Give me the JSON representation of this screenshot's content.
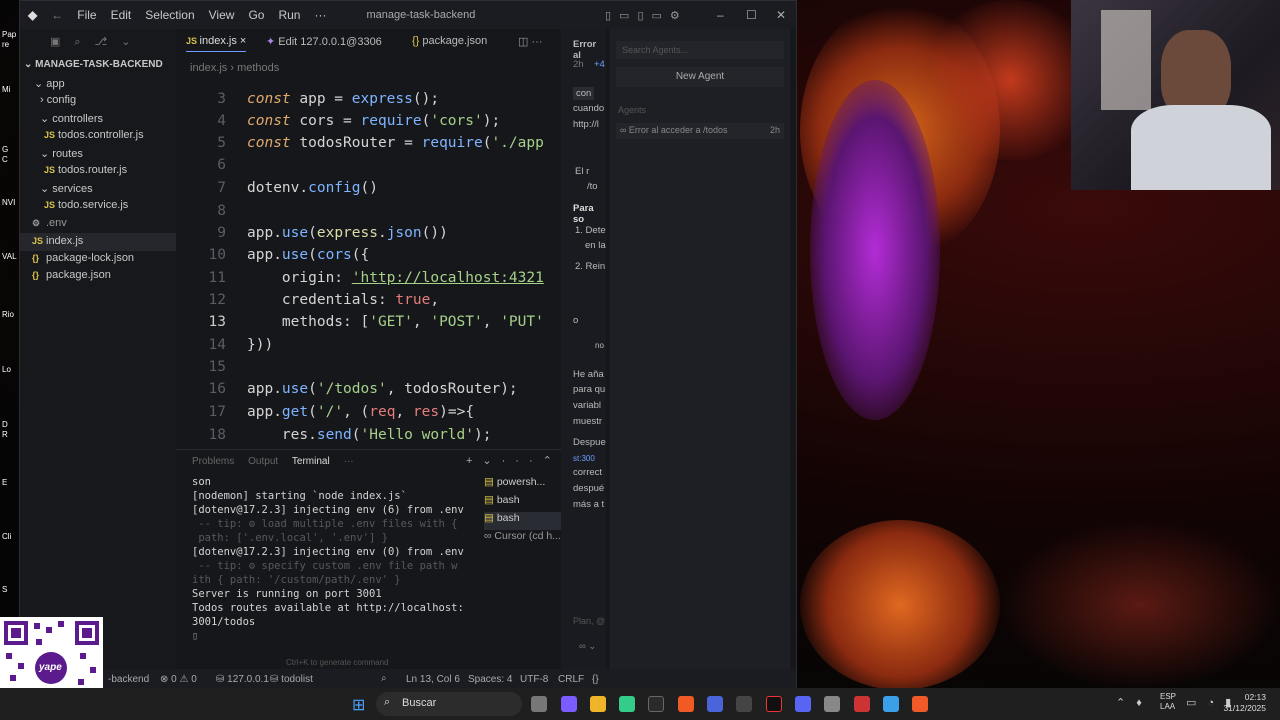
{
  "window": {
    "title": "manage-task-backend",
    "menu": [
      "File",
      "Edit",
      "Selection",
      "View",
      "Go",
      "Run",
      "···"
    ]
  },
  "tabs": [
    {
      "label": "index.js",
      "close": "×"
    },
    {
      "label": "Edit 127.0.0.1@3306"
    },
    {
      "label": "package.json"
    }
  ],
  "breadcrumb": {
    "file": "index.js",
    "sep": "›",
    "symbol": "methods"
  },
  "explorer": {
    "root": "MANAGE-TASK-BACKEND",
    "items": [
      {
        "label": "app",
        "icon": ""
      },
      {
        "label": "config",
        "icon": ""
      },
      {
        "label": "controllers",
        "icon": ""
      },
      {
        "label": "todos.controller.js",
        "icon": "JS"
      },
      {
        "label": "routes",
        "icon": ""
      },
      {
        "label": "todos.router.js",
        "icon": "JS"
      },
      {
        "label": "services",
        "icon": ""
      },
      {
        "label": "todo.service.js",
        "icon": "JS"
      },
      {
        "label": ".env",
        "icon": "⚙"
      },
      {
        "label": "index.js",
        "icon": "JS"
      },
      {
        "label": "package-lock.json",
        "icon": "{}"
      },
      {
        "label": "package.json",
        "icon": "{}"
      }
    ]
  },
  "code": {
    "lines": [
      "3",
      "4",
      "5",
      "6",
      "7",
      "8",
      "9",
      "10",
      "11",
      "12",
      "13",
      "14",
      "15",
      "16",
      "17",
      "18"
    ],
    "l3": [
      "const",
      " app = ",
      "express",
      "();"
    ],
    "l4": [
      "const",
      " cors = ",
      "require",
      "(",
      "'cors'",
      ");"
    ],
    "l5": [
      "const",
      " todosRouter = ",
      "require",
      "(",
      "'./app"
    ],
    "l7": [
      "dotenv.",
      "config",
      "()"
    ],
    "l9": [
      "app.",
      "use",
      "(",
      "express",
      ".",
      "json",
      "())"
    ],
    "l10": [
      "app.",
      "use",
      "(",
      "cors",
      "({"
    ],
    "l11": [
      "    origin: ",
      "'http://localhost:4321"
    ],
    "l12": [
      "    credentials: ",
      "true",
      ","
    ],
    "l13": [
      "    methods: [",
      "'GET'",
      ", ",
      "'POST'",
      ", ",
      "'PUT'"
    ],
    "l14": [
      "}))"
    ],
    "l16": [
      "app.",
      "use",
      "(",
      "'/todos'",
      ", todosRouter);"
    ],
    "l17": [
      "app.",
      "get",
      "(",
      "'/'",
      ", (",
      "req",
      ", ",
      "res",
      ")=>{"
    ],
    "l18": [
      "    res.",
      "send",
      "(",
      "'Hello world'",
      ");"
    ]
  },
  "panel": {
    "tabs": [
      "Problems",
      "Output",
      "Terminal",
      "···"
    ],
    "terminal": [
      "son",
      "[nodemon] starting `node index.js`",
      "[dotenv@17.2.3] injecting env (6) from .env",
      " -- tip: ⚙ load multiple .env files with {",
      " path: ['.env.local', '.env'] }",
      "[dotenv@17.2.3] injecting env (0) from .env",
      " -- tip: ⚙ specify custom .env file path w",
      "ith { path: '/custom/path/.env' }",
      "Server is running on port 3001",
      "Todos routes available at http://localhost:",
      "3001/todos"
    ],
    "terms": [
      "powersh...",
      "bash",
      "bash",
      "Cursor (cd h..."
    ],
    "hint": "Ctrl+K to generate command"
  },
  "chat": {
    "title": "Error al",
    "lines": [
      "2h",
      "+4",
      "con",
      "cuando",
      "http://l",
      "El r",
      "/to",
      "Para so",
      "1. Dete",
      "en la",
      "2. Rein",
      "o",
      "no",
      "He aña",
      "para qu",
      "variabl",
      "muestr",
      "Despue",
      "st:300",
      "correct",
      "despué",
      "más a t"
    ]
  },
  "agents": {
    "search": "Search Agents...",
    "new": "New Agent",
    "section": "Agents",
    "item": "Error al acceder a /todos",
    "age": "2h",
    "plan": "Plan, @"
  },
  "status": {
    "branch": "-backend",
    "errors": "0",
    "warnings": "0",
    "host": "127.0.0.1",
    "todo": "todolist",
    "pos": "Ln 13, Col 6",
    "spaces": "Spaces: 4",
    "enc": "UTF-8",
    "eol": "CRLF",
    "lang": "{}"
  },
  "taskbar": {
    "search": "Buscar",
    "lang1": "ESP",
    "lang2": "LAA",
    "time": "02:13",
    "date": "31/12/2025"
  },
  "qr": {
    "brand": "yape"
  },
  "desktop_labels": [
    "Pap",
    "re",
    "Mi",
    "G",
    "C",
    "NVI",
    "VAL",
    "Rio",
    "Lo",
    "D",
    "R",
    "E",
    "Cli",
    "S"
  ]
}
